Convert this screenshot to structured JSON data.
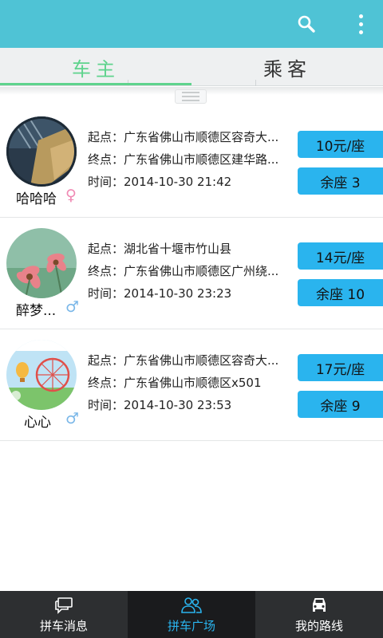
{
  "action_bar": {
    "color": "#4fc3d5",
    "search_icon": "search-icon",
    "overflow_icon": "overflow-menu-icon"
  },
  "tabs": [
    {
      "label": "车主",
      "active": true
    },
    {
      "label": "乘客",
      "active": false
    }
  ],
  "rides": [
    {
      "username": "哈哈哈",
      "gender": "female",
      "gender_symbol": "♀",
      "gender_color": "#f08ab4",
      "start": "起点：广东省佛山市顺德区容奇大...",
      "end": "终点：广东省佛山市顺德区建华路...",
      "time": "时间：2014-10-30 21:42",
      "price": "10元/座",
      "seats": "余座 3"
    },
    {
      "username": "醉梦...",
      "gender": "male",
      "gender_symbol": "♂",
      "gender_color": "#7ab7e8",
      "start": "起点：湖北省十堰市竹山县",
      "end": "终点：广东省佛山市顺德区广州绕...",
      "time": "时间：2014-10-30 23:23",
      "price": "14元/座",
      "seats": "余座 10"
    },
    {
      "username": "心心",
      "gender": "male",
      "gender_symbol": "♂",
      "gender_color": "#7ab7e8",
      "start": "起点：广东省佛山市顺德区容奇大...",
      "end": "终点：广东省佛山市顺德区x501",
      "time": "时间：2014-10-30 23:53",
      "price": "17元/座",
      "seats": "余座 9"
    }
  ],
  "bottom_nav": [
    {
      "label": "拼车消息",
      "icon": "chat-icon",
      "active": false
    },
    {
      "label": "拼车广场",
      "icon": "people-icon",
      "active": true
    },
    {
      "label": "我的路线",
      "icon": "car-icon",
      "active": false
    }
  ],
  "colors": {
    "accent_green": "#5fd38d",
    "accent_blue": "#2ab4ee",
    "nav_bg": "#2d2f31"
  }
}
